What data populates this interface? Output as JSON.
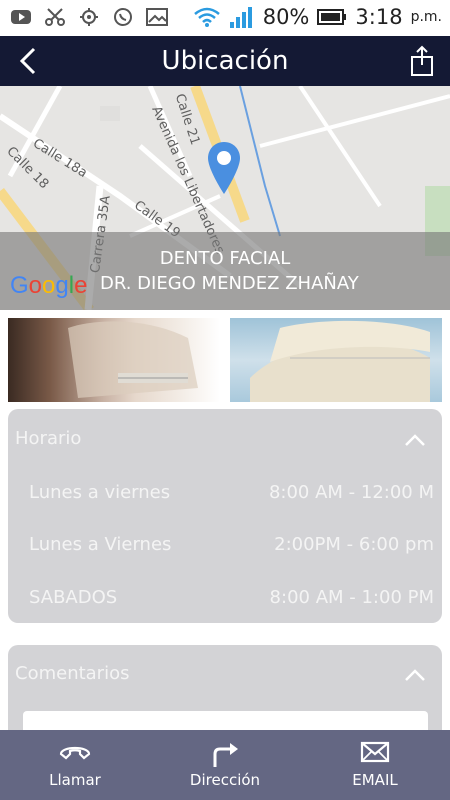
{
  "status_bar": {
    "battery_percent": "80%",
    "time": "3:18",
    "ampm": "p.m."
  },
  "header": {
    "title": "Ubicación"
  },
  "map": {
    "streets": [
      "Calle 21",
      "Avenida los Libertadores",
      "Calle 18a",
      "Calle 18",
      "Carrera 35A",
      "Calle 19"
    ],
    "place_line1": "DENTO FACIAL",
    "place_line2": "DR. DIEGO MENDEZ ZHAÑAY",
    "google_letters": [
      "G",
      "o",
      "o",
      "g",
      "l",
      "e"
    ],
    "google_colors": [
      "#4285F4",
      "#EA4335",
      "#FBBC05",
      "#4285F4",
      "#34A853",
      "#EA4335"
    ]
  },
  "schedule": {
    "header": "Horario",
    "rows": [
      {
        "day": "Lunes a viernes",
        "hours": "8:00 AM - 12:00 M"
      },
      {
        "day": "Lunes a Viernes",
        "hours": "2:00PM - 6:00 pm"
      },
      {
        "day": "SABADOS",
        "hours": "8:00 AM - 1:00 PM"
      }
    ]
  },
  "comments": {
    "header": "Comentarios"
  },
  "bottom_nav": {
    "call_label": "Llamar",
    "directions_label": "Dirección",
    "email_label": "EMAIL"
  },
  "colors": {
    "app_bar": "#141934",
    "bottom_bar": "#646783",
    "card": "#d3d3d6",
    "pin": "#4a8fe0"
  }
}
